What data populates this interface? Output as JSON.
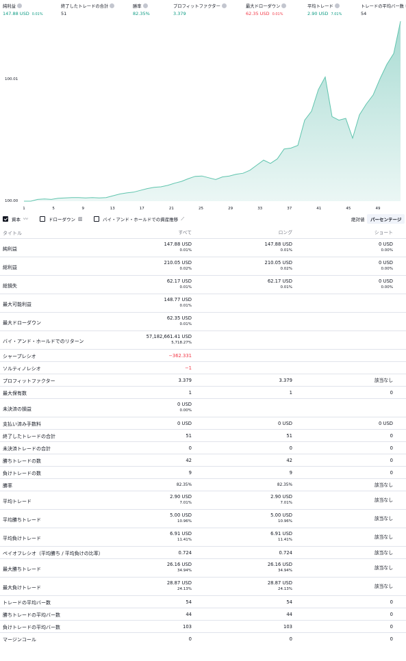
{
  "summary": [
    {
      "label": "純利益",
      "value": "147.88 USD",
      "pct": "0.01%",
      "color": "green"
    },
    {
      "label": "終了したトレードの合計",
      "value": "51",
      "pct": "",
      "color": "dark"
    },
    {
      "label": "勝率",
      "value": "82.35%",
      "pct": "",
      "color": "green"
    },
    {
      "label": "プロフィットファクター",
      "value": "3.379",
      "pct": "",
      "color": "green"
    },
    {
      "label": "最大ドローダウン",
      "value": "62.35 USD",
      "pct": "0.01%",
      "color": "red"
    },
    {
      "label": "平均トレード",
      "value": "2.90 USD",
      "pct": "7.01%",
      "color": "green"
    },
    {
      "label": "トレードの平均バー数",
      "value": "54",
      "pct": "",
      "color": "dark"
    }
  ],
  "chart_data": {
    "type": "area",
    "x": [
      1,
      2,
      3,
      4,
      5,
      6,
      7,
      8,
      9,
      10,
      11,
      12,
      13,
      14,
      15,
      16,
      17,
      18,
      19,
      20,
      21,
      22,
      23,
      24,
      25,
      26,
      27,
      28,
      29,
      30,
      31,
      32,
      33,
      34,
      35,
      36,
      37,
      38,
      39,
      40,
      41,
      42,
      43,
      44,
      45,
      46,
      47,
      48,
      49,
      50,
      51,
      52
    ],
    "values": [
      100.0,
      100.0,
      100.0,
      100.0,
      100.0,
      100.0,
      100.0,
      100.0,
      100.0,
      100.0,
      100.0,
      100.0,
      100.0,
      100.0,
      100.0,
      100.0,
      100.0,
      100.0,
      100.0,
      100.0,
      100.0,
      100.0,
      100.0,
      100.0,
      100.0,
      100.0,
      100.0,
      100.0,
      100.0,
      100.0,
      100.0,
      100.0,
      100.0,
      100.0,
      100.0,
      100.0,
      100.0,
      100.0,
      100.0,
      100.0,
      100.01,
      100.01,
      100.01,
      100.01,
      100.0,
      100.01,
      100.01,
      100.01,
      100.01,
      100.01,
      100.01,
      100.02
    ],
    "series_color": "#089981",
    "y_tick_labels": [
      "100.01",
      "100.00"
    ],
    "x_tick_labels": [
      "1",
      "5",
      "9",
      "13",
      "17",
      "21",
      "25",
      "29",
      "33",
      "37",
      "41",
      "45",
      "49"
    ],
    "grid": false
  },
  "toggles": {
    "equity": "資本",
    "drawdown": "ドローダウン",
    "buyhold": "バイ・アンド・ホールドでの資産推移",
    "absolute": "絶対値",
    "percentage": "パーセンテージ"
  },
  "columns": [
    "タイトル",
    "すべて",
    "ロング",
    "ショート"
  ],
  "rows": [
    {
      "title": "純利益",
      "all": "147.88 USD",
      "all_sub": "0.01%",
      "long": "147.88 USD",
      "long_sub": "0.01%",
      "short": "0 USD",
      "short_sub": "0.00%"
    },
    {
      "title": "総利益",
      "all": "210.05 USD",
      "all_sub": "0.02%",
      "long": "210.05 USD",
      "long_sub": "0.02%",
      "short": "0 USD",
      "short_sub": "0.00%"
    },
    {
      "title": "総損失",
      "all": "62.17 USD",
      "all_sub": "0.01%",
      "long": "62.17 USD",
      "long_sub": "0.01%",
      "short": "0 USD",
      "short_sub": "0.00%"
    },
    {
      "title": "最大可能利益",
      "all": "148.77 USD",
      "all_sub": "0.01%"
    },
    {
      "title": "最大ドローダウン",
      "all": "62.35 USD",
      "all_sub": "0.01%"
    },
    {
      "title": "バイ・アンド・ホールドでのリターン",
      "all": "57,182,661.41 USD",
      "all_sub": "5,718.27%"
    },
    {
      "title": "シャープレシオ",
      "all": "−362.331",
      "all_color": "red"
    },
    {
      "title": "ソルティノレシオ",
      "all": "−1",
      "all_color": "red"
    },
    {
      "title": "プロフィットファクター",
      "all": "3.379",
      "long": "3.379",
      "short": "該当なし"
    },
    {
      "title": "最大保有数",
      "all": "1",
      "long": "1",
      "short": "0"
    },
    {
      "title": "未決済の損益",
      "all": "0 USD",
      "all_sub": "0.00%"
    },
    {
      "title": "支払い済み手数料",
      "all": "0 USD",
      "long": "0 USD",
      "short": "0 USD"
    },
    {
      "title": "終了したトレードの合計",
      "all": "51",
      "long": "51",
      "short": "0"
    },
    {
      "title": "未決済トレードの合計",
      "all": "0",
      "long": "0",
      "short": "0"
    },
    {
      "title": "勝ちトレードの数",
      "all": "42",
      "long": "42",
      "short": "0"
    },
    {
      "title": "負けトレードの数",
      "all": "9",
      "long": "9",
      "short": "0"
    },
    {
      "title": "勝率",
      "all_small": "82.35%",
      "long_small": "82.35%",
      "short": "該当なし"
    },
    {
      "title": "平均トレード",
      "all": "2.90 USD",
      "all_sub": "7.01%",
      "long": "2.90 USD",
      "long_sub": "7.01%",
      "short": "該当なし"
    },
    {
      "title": "平均勝ちトレード",
      "all": "5.00 USD",
      "all_sub": "10.96%",
      "long": "5.00 USD",
      "long_sub": "10.96%",
      "short": "該当なし"
    },
    {
      "title": "平均負けトレード",
      "all": "6.91 USD",
      "all_sub": "11.41%",
      "long": "6.91 USD",
      "long_sub": "11.41%",
      "short": "該当なし"
    },
    {
      "title": "ペイオフレシオ（平均勝ち / 平均負けの比率）",
      "all": "0.724",
      "long": "0.724",
      "short": "該当なし"
    },
    {
      "title": "最大勝ちトレード",
      "all": "26.16 USD",
      "all_sub": "34.94%",
      "long": "26.16 USD",
      "long_sub": "34.94%",
      "short": "該当なし"
    },
    {
      "title": "最大負けトレード",
      "all": "28.87 USD",
      "all_sub": "24.13%",
      "long": "28.87 USD",
      "long_sub": "24.13%",
      "short": "該当なし"
    },
    {
      "title": "トレードの平均バー数",
      "all": "54",
      "long": "54",
      "short": "0"
    },
    {
      "title": "勝ちトレードの平均バー数",
      "all": "44",
      "long": "44",
      "short": "0"
    },
    {
      "title": "負けトレードの平均バー数",
      "all": "103",
      "long": "103",
      "short": "0"
    },
    {
      "title": "マージンコール",
      "all": "0",
      "long": "0",
      "short": "0"
    }
  ]
}
